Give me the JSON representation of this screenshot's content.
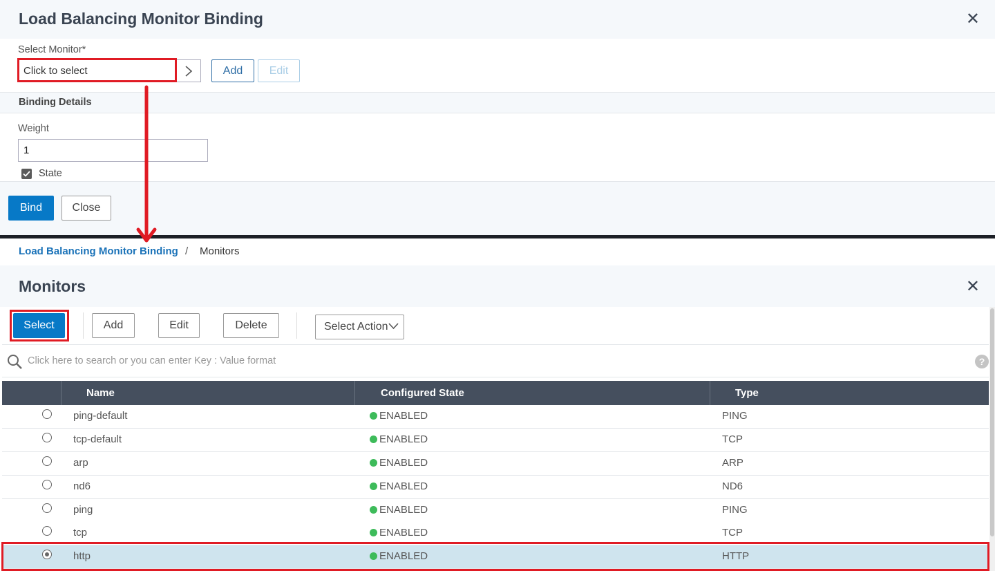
{
  "binding_dialog": {
    "title": "Load Balancing Monitor Binding",
    "select_monitor_label": "Select Monitor*",
    "select_monitor_placeholder": "Click to select",
    "add_label": "Add",
    "edit_label": "Edit",
    "binding_details_label": "Binding Details",
    "weight_label": "Weight",
    "weight_value": "1",
    "state_label": "State",
    "state_checked": true,
    "bind_label": "Bind",
    "close_label": "Close"
  },
  "breadcrumb": {
    "parent": "Load Balancing Monitor Binding",
    "separator": "/",
    "current": "Monitors"
  },
  "monitors_dialog": {
    "title": "Monitors",
    "toolbar": {
      "select_label": "Select",
      "add_label": "Add",
      "edit_label": "Edit",
      "delete_label": "Delete",
      "action_label": "Select Action"
    },
    "search_placeholder": "Click here to search or you can enter Key : Value format",
    "columns": [
      "Name",
      "Configured State",
      "Type"
    ],
    "rows": [
      {
        "name": "ping-default",
        "state": "ENABLED",
        "type": "PING",
        "selected": false
      },
      {
        "name": "tcp-default",
        "state": "ENABLED",
        "type": "TCP",
        "selected": false
      },
      {
        "name": "arp",
        "state": "ENABLED",
        "type": "ARP",
        "selected": false
      },
      {
        "name": "nd6",
        "state": "ENABLED",
        "type": "ND6",
        "selected": false
      },
      {
        "name": "ping",
        "state": "ENABLED",
        "type": "PING",
        "selected": false
      },
      {
        "name": "tcp",
        "state": "ENABLED",
        "type": "TCP",
        "selected": false
      },
      {
        "name": "http",
        "state": "ENABLED",
        "type": "HTTP",
        "selected": true
      }
    ]
  },
  "colors": {
    "primary": "#0779c7",
    "highlight": "#e01b24",
    "enabled": "#3dbb5a",
    "header_bg": "#454f5e",
    "selected_row": "#cfe4ee"
  }
}
